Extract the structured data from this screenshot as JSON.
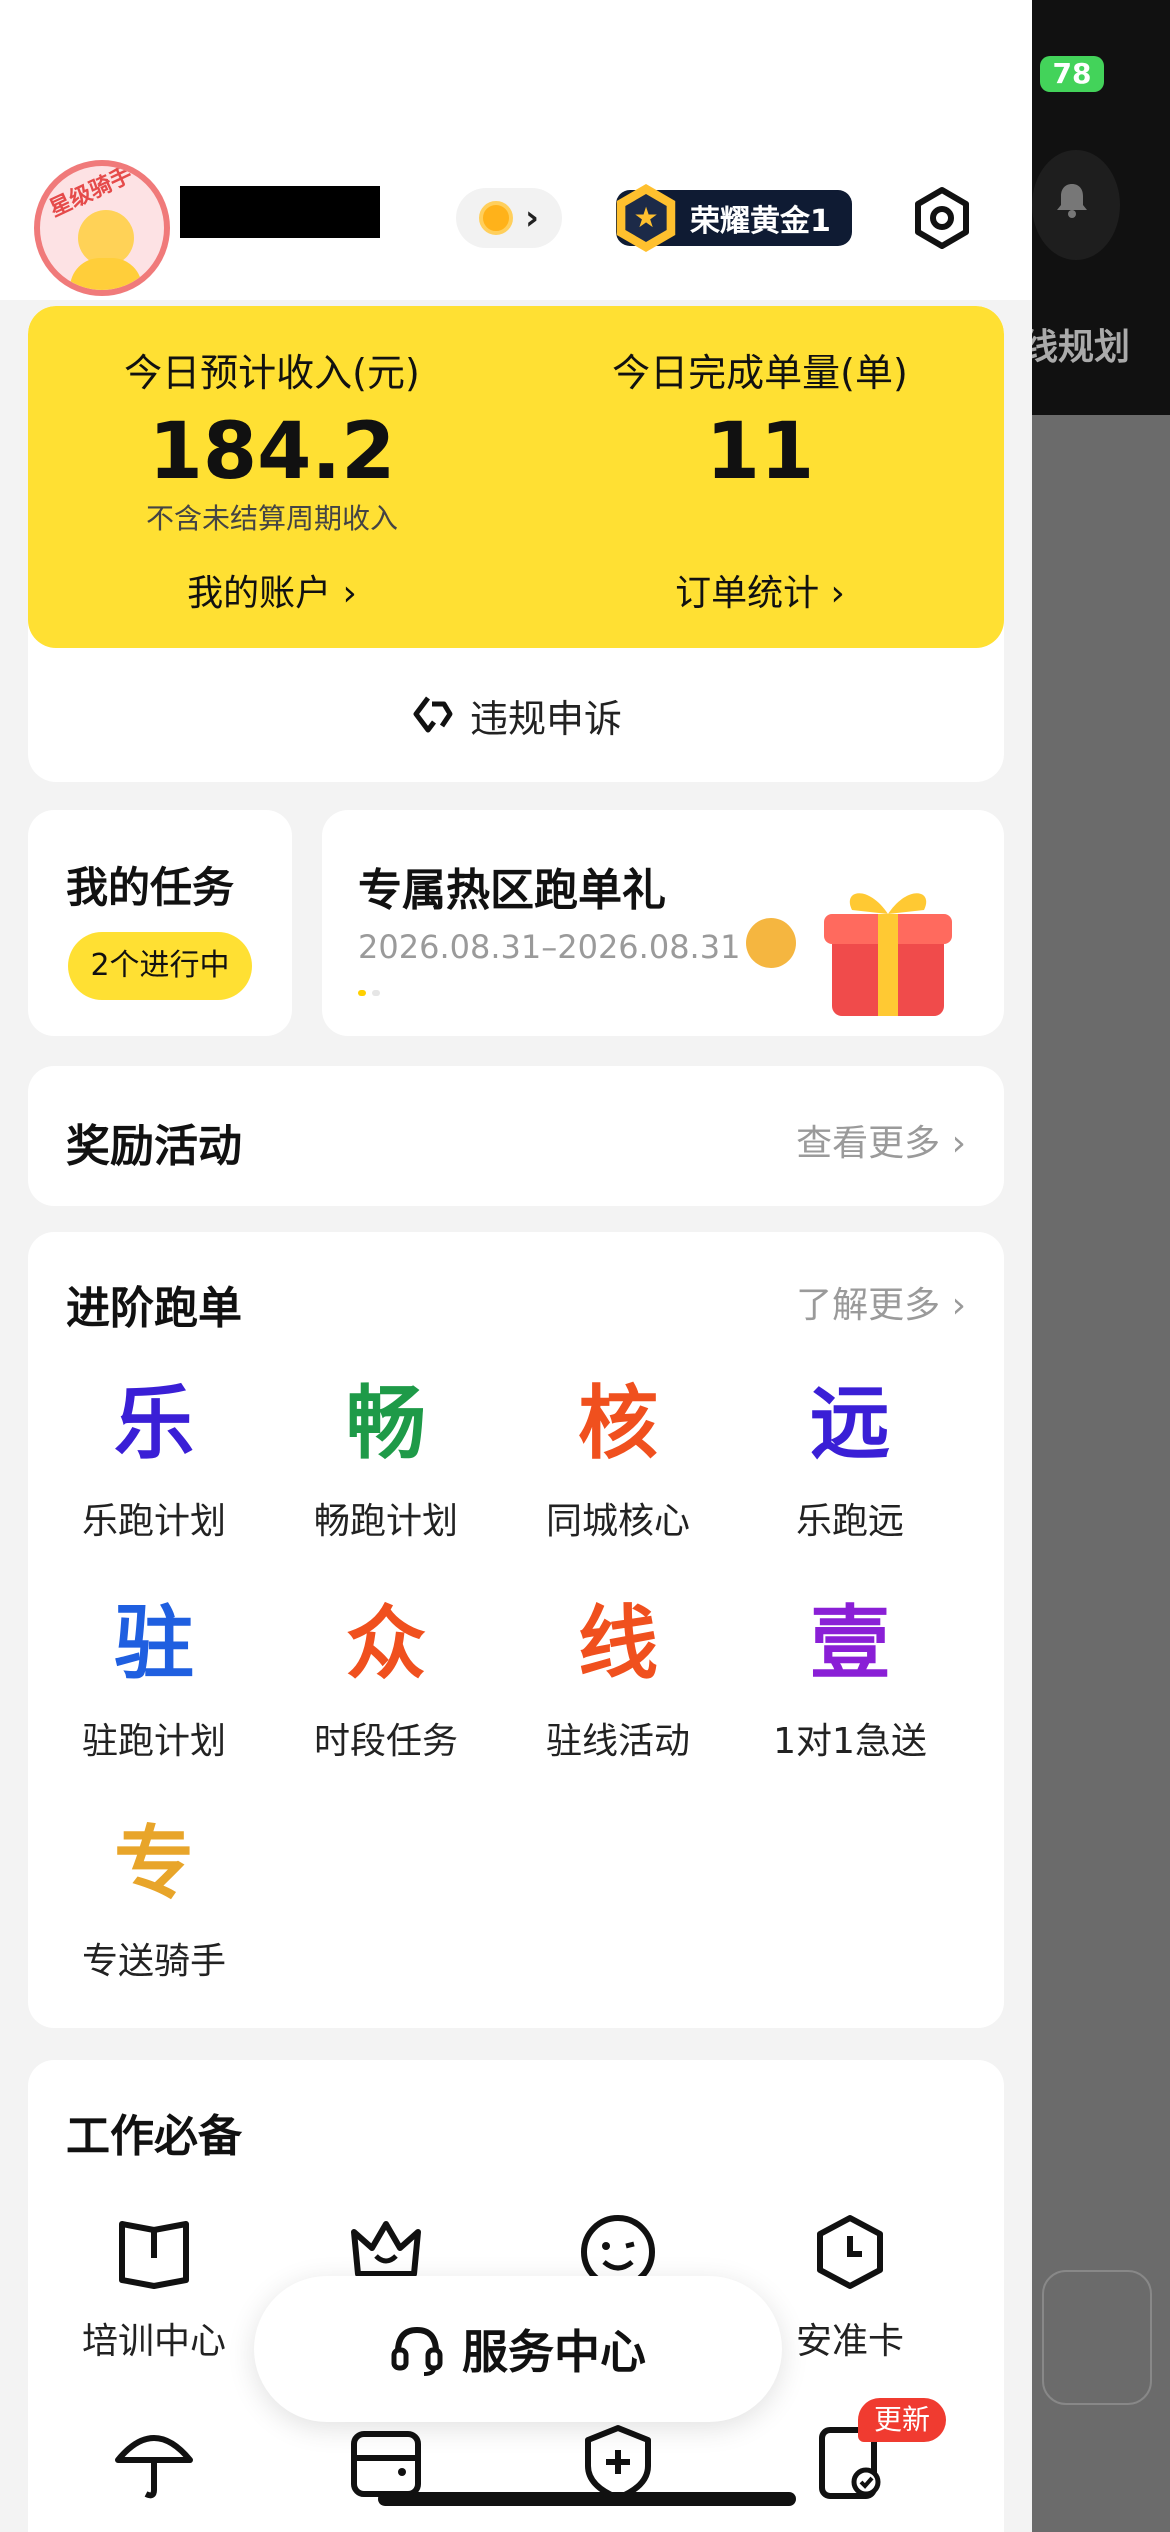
{
  "status_bar": {
    "battery": "78"
  },
  "underlay": {
    "route_text": "线规划"
  },
  "header": {
    "avatar_label": "星级骑手",
    "level_badge": "荣耀黄金1"
  },
  "income": {
    "left_label": "今日预计收入(元)",
    "left_value": "184.2",
    "left_note": "不含未结算周期收入",
    "left_link": "我的账户 ›",
    "right_label": "今日完成单量(单)",
    "right_value": "11",
    "right_link": "订单统计 ›",
    "appeal": "违规申诉"
  },
  "task": {
    "title": "我的任务",
    "status": "2个进行中"
  },
  "promo": {
    "title": "专属热区跑单礼",
    "date": "2026.08.31–2026.08.31"
  },
  "rewards": {
    "title": "奖励活动",
    "more": "查看更多"
  },
  "advanced": {
    "title": "进阶跑单",
    "more": "了解更多",
    "items": [
      {
        "glyph": "乐",
        "label": "乐跑计划",
        "color": "#3a1fd6"
      },
      {
        "glyph": "畅",
        "label": "畅跑计划",
        "color": "#1e9a48"
      },
      {
        "glyph": "核",
        "label": "同城核心",
        "color": "#f0501e"
      },
      {
        "glyph": "远",
        "label": "乐跑远",
        "color": "#3a1fd6"
      },
      {
        "glyph": "驻",
        "label": "驻跑计划",
        "color": "#1f5fe0"
      },
      {
        "glyph": "众",
        "label": "时段任务",
        "color": "#f0501e"
      },
      {
        "glyph": "线",
        "label": "驻线活动",
        "color": "#f0501e"
      },
      {
        "glyph": "壹",
        "label": "1对1急送",
        "color": "#8a1fd6"
      },
      {
        "glyph": "专",
        "label": "专送骑手",
        "color": "#e8a52a"
      }
    ]
  },
  "tools": {
    "title": "工作必备",
    "items": [
      {
        "icon": "book-icon",
        "label": "培训中心"
      },
      {
        "icon": "crown-icon",
        "label": ""
      },
      {
        "icon": "smile-icon",
        "label": ""
      },
      {
        "icon": "clock-shield-icon",
        "label": "安准卡"
      },
      {
        "icon": "umbrella-icon",
        "label": ""
      },
      {
        "icon": "wallet-icon",
        "label": ""
      },
      {
        "icon": "medical-shield-icon",
        "label": ""
      },
      {
        "icon": "document-check-icon",
        "label": ""
      }
    ],
    "new_badge": "更新"
  },
  "service": {
    "label": "服务中心"
  }
}
